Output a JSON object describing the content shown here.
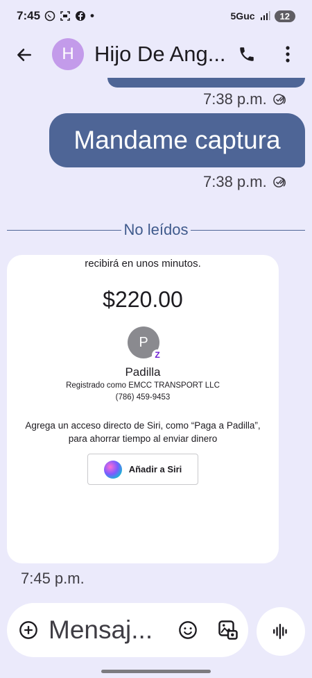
{
  "status_bar": {
    "time": "7:45",
    "network": "5Guc",
    "battery": "12",
    "dot": "•"
  },
  "header": {
    "avatar_letter": "H",
    "contact_name": "Hijo De Ang...",
    "avatar_color": "#c39bea"
  },
  "messages": [
    {
      "time": "7:38 p.m."
    },
    {
      "text": "Mandame captura",
      "time": "7:38 p.m."
    }
  ],
  "divider_label": "No leídos",
  "payment_card": {
    "top_text": "recibirá en unos minutos.",
    "amount": "$220.00",
    "payee_initial": "P",
    "payee_name": "Padilla",
    "registered_as": "Registrado como EMCC TRANSPORT LLC",
    "phone": "(786) 459-9453",
    "siri_note_line1": "Agrega un acceso directo de Siri, como “Paga a Padilla”,",
    "siri_note_line2": "para ahorrar tiempo al enviar dinero",
    "siri_button_label": "Añadir a Siri",
    "zelle_glyph": "Z",
    "time": "7:45 p.m."
  },
  "composer": {
    "placeholder": "Mensaj..."
  },
  "colors": {
    "background": "#ebeafb",
    "sent_bubble": "#4e6596",
    "card": "#ffffff"
  }
}
